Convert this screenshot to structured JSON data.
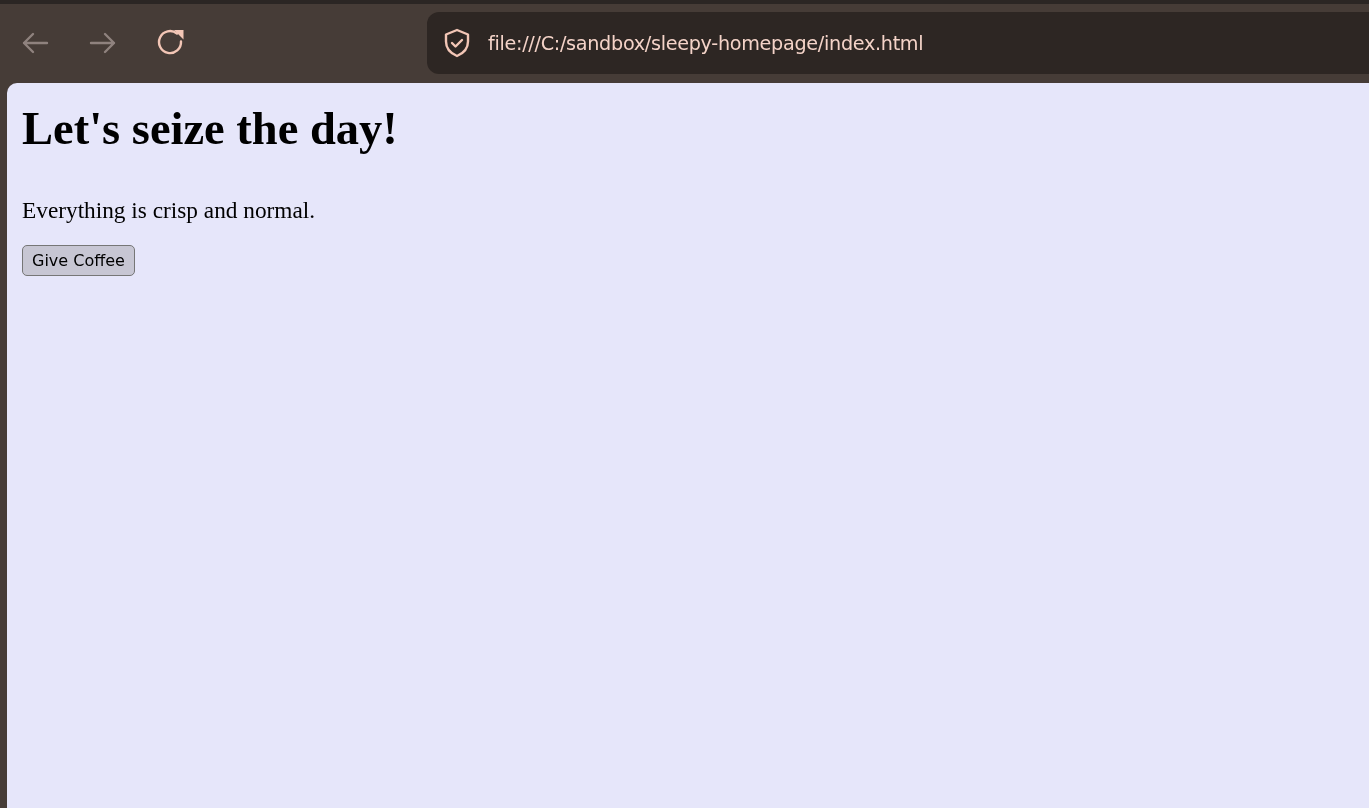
{
  "toolbar": {
    "nav_buttons": [
      {
        "kind": "back",
        "disabled": true
      },
      {
        "kind": "forward",
        "disabled": true
      },
      {
        "kind": "reload",
        "disabled": false
      }
    ],
    "address_bar": {
      "url": "file:///C:/sandbox/sleepy-homepage/index.html"
    }
  },
  "page": {
    "heading": "Let's seize the day!",
    "paragraph": "Everything is crisp and normal.",
    "buttons": [
      "Give Coffee"
    ]
  }
}
